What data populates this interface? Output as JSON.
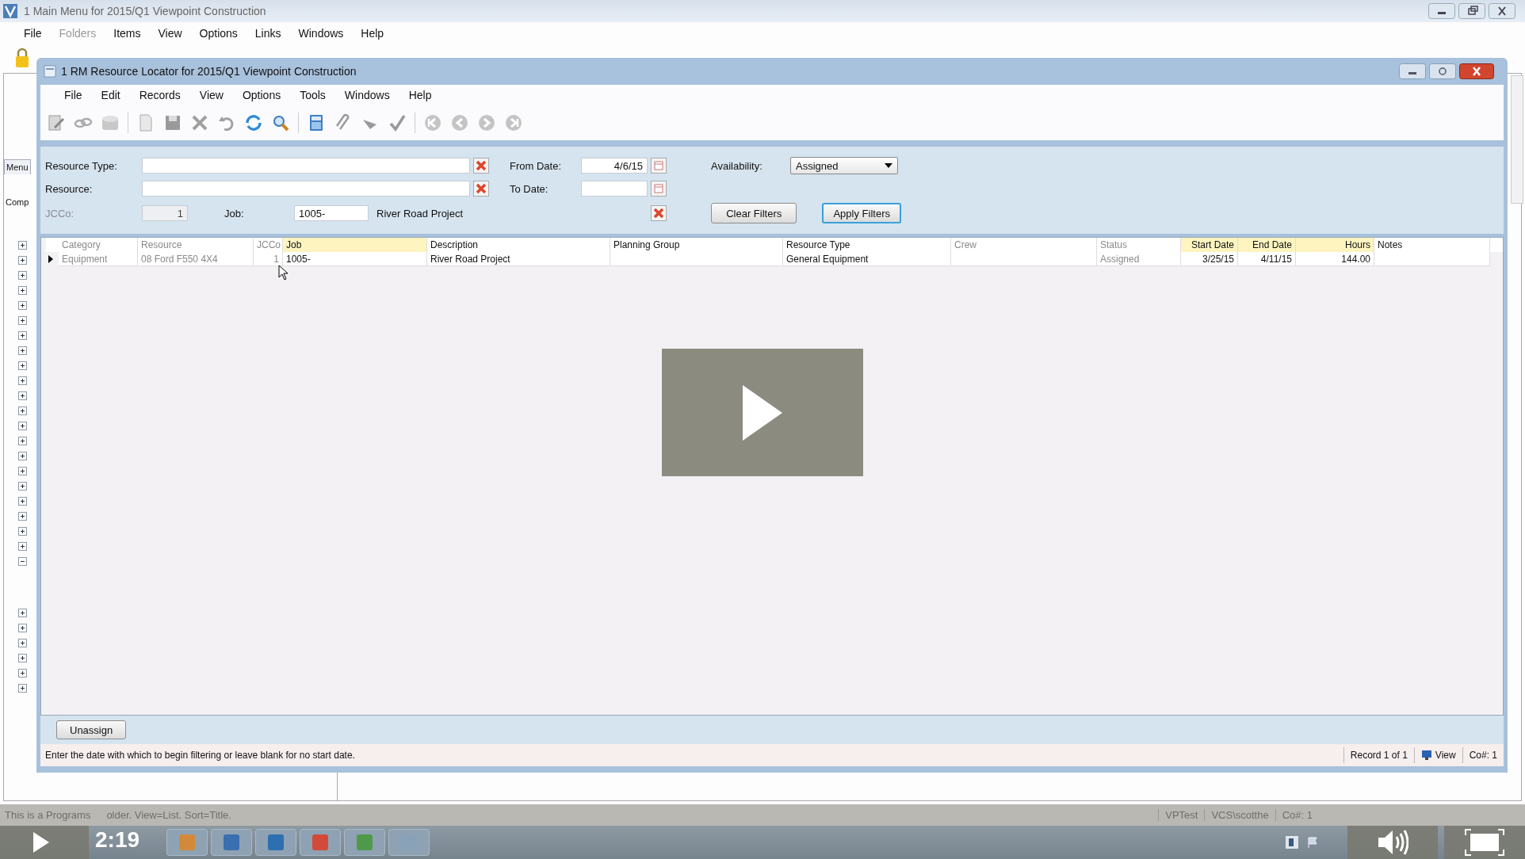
{
  "main_window": {
    "title": "1 Main Menu for 2015/Q1 Viewpoint Construction",
    "menu": [
      {
        "label": "File",
        "disabled": false
      },
      {
        "label": "Folders",
        "disabled": true
      },
      {
        "label": "Items",
        "disabled": false
      },
      {
        "label": "View",
        "disabled": false
      },
      {
        "label": "Options",
        "disabled": false
      },
      {
        "label": "Links",
        "disabled": false
      },
      {
        "label": "Windows",
        "disabled": false
      },
      {
        "label": "Help",
        "disabled": false
      }
    ],
    "side_tabs": [
      {
        "label": "Menu",
        "selected": true
      },
      {
        "label": "Comp",
        "selected": false
      }
    ],
    "tree_nodes": [
      {
        "expanded": false
      },
      {
        "expanded": false
      },
      {
        "expanded": false
      },
      {
        "expanded": false
      },
      {
        "expanded": false
      },
      {
        "expanded": false
      },
      {
        "expanded": false
      },
      {
        "expanded": false
      },
      {
        "expanded": false
      },
      {
        "expanded": false
      },
      {
        "expanded": false
      },
      {
        "expanded": false
      },
      {
        "expanded": false
      },
      {
        "expanded": false
      },
      {
        "expanded": false
      },
      {
        "expanded": false
      },
      {
        "expanded": false
      },
      {
        "expanded": false
      },
      {
        "expanded": false
      },
      {
        "expanded": false
      },
      {
        "expanded": false
      },
      {
        "expanded": true
      },
      {
        "expanded": false
      },
      {
        "expanded": false
      },
      {
        "expanded": false
      },
      {
        "expanded": false
      },
      {
        "expanded": false
      },
      {
        "expanded": false
      }
    ]
  },
  "locator": {
    "title": "1 RM Resource Locator for 2015/Q1 Viewpoint Construction",
    "menu": [
      "File",
      "Edit",
      "Records",
      "View",
      "Options",
      "Tools",
      "Windows",
      "Help"
    ],
    "filters": {
      "resource_type": {
        "label": "Resource Type:"
      },
      "resource": {
        "label": "Resource:"
      },
      "jcco": {
        "label": "JCCo:",
        "value": "1",
        "disabled": true
      },
      "job": {
        "label": "Job:",
        "value": "1005-",
        "description": "River Road Project"
      },
      "from_date": {
        "label": "From Date:",
        "value": "4/6/15"
      },
      "to_date": {
        "label": "To Date:"
      },
      "availability": {
        "label": "Availability:",
        "value": "Assigned"
      },
      "buttons": [
        {
          "label": "Clear Filters",
          "focused": false
        },
        {
          "label": "Apply Filters",
          "focused": true
        }
      ]
    },
    "grid": {
      "columns": [
        {
          "label": "Category",
          "muted": true,
          "highlighted": false,
          "kind": "text"
        },
        {
          "label": "Resource",
          "muted": true,
          "highlighted": false,
          "kind": "text"
        },
        {
          "label": "JCCo",
          "muted": true,
          "highlighted": false,
          "kind": "number"
        },
        {
          "label": "Job",
          "muted": false,
          "highlighted": true,
          "kind": "text"
        },
        {
          "label": "Description",
          "muted": false,
          "highlighted": false,
          "kind": "text"
        },
        {
          "label": "Planning Group",
          "muted": false,
          "highlighted": false,
          "kind": "text"
        },
        {
          "label": "Resource Type",
          "muted": false,
          "highlighted": false,
          "kind": "text"
        },
        {
          "label": "Crew",
          "muted": true,
          "highlighted": false,
          "kind": "text"
        },
        {
          "label": "Status",
          "muted": true,
          "highlighted": false,
          "kind": "text"
        },
        {
          "label": "Start Date",
          "muted": false,
          "highlighted": true,
          "kind": "number"
        },
        {
          "label": "End Date",
          "muted": false,
          "highlighted": true,
          "kind": "number"
        },
        {
          "label": "Hours",
          "muted": false,
          "highlighted": true,
          "kind": "number"
        },
        {
          "label": "Notes",
          "muted": false,
          "highlighted": false,
          "kind": "text"
        }
      ],
      "rows": [
        {
          "selected": true,
          "cells": [
            "Equipment",
            "08 Ford F550 4X4",
            "1",
            "1005-",
            "River Road Project",
            null,
            "General Equipment",
            null,
            "Assigned",
            "3/25/15",
            "4/11/15",
            "144.00",
            null
          ]
        }
      ]
    },
    "bottom_buttons": [
      "Unassign"
    ],
    "status": {
      "message": "Enter the date with which to begin filtering or leave blank for no start date.",
      "record": "Record 1 of 1",
      "mode": "View",
      "company": "Co#: 1"
    }
  },
  "background_status": {
    "left": "This is a Programs",
    "middle": "older. View=List. Sort=Title.",
    "right": [
      "VPTest",
      "VCS\\scotthe",
      "Co#: 1"
    ]
  },
  "player": {
    "time": "2:19"
  }
}
